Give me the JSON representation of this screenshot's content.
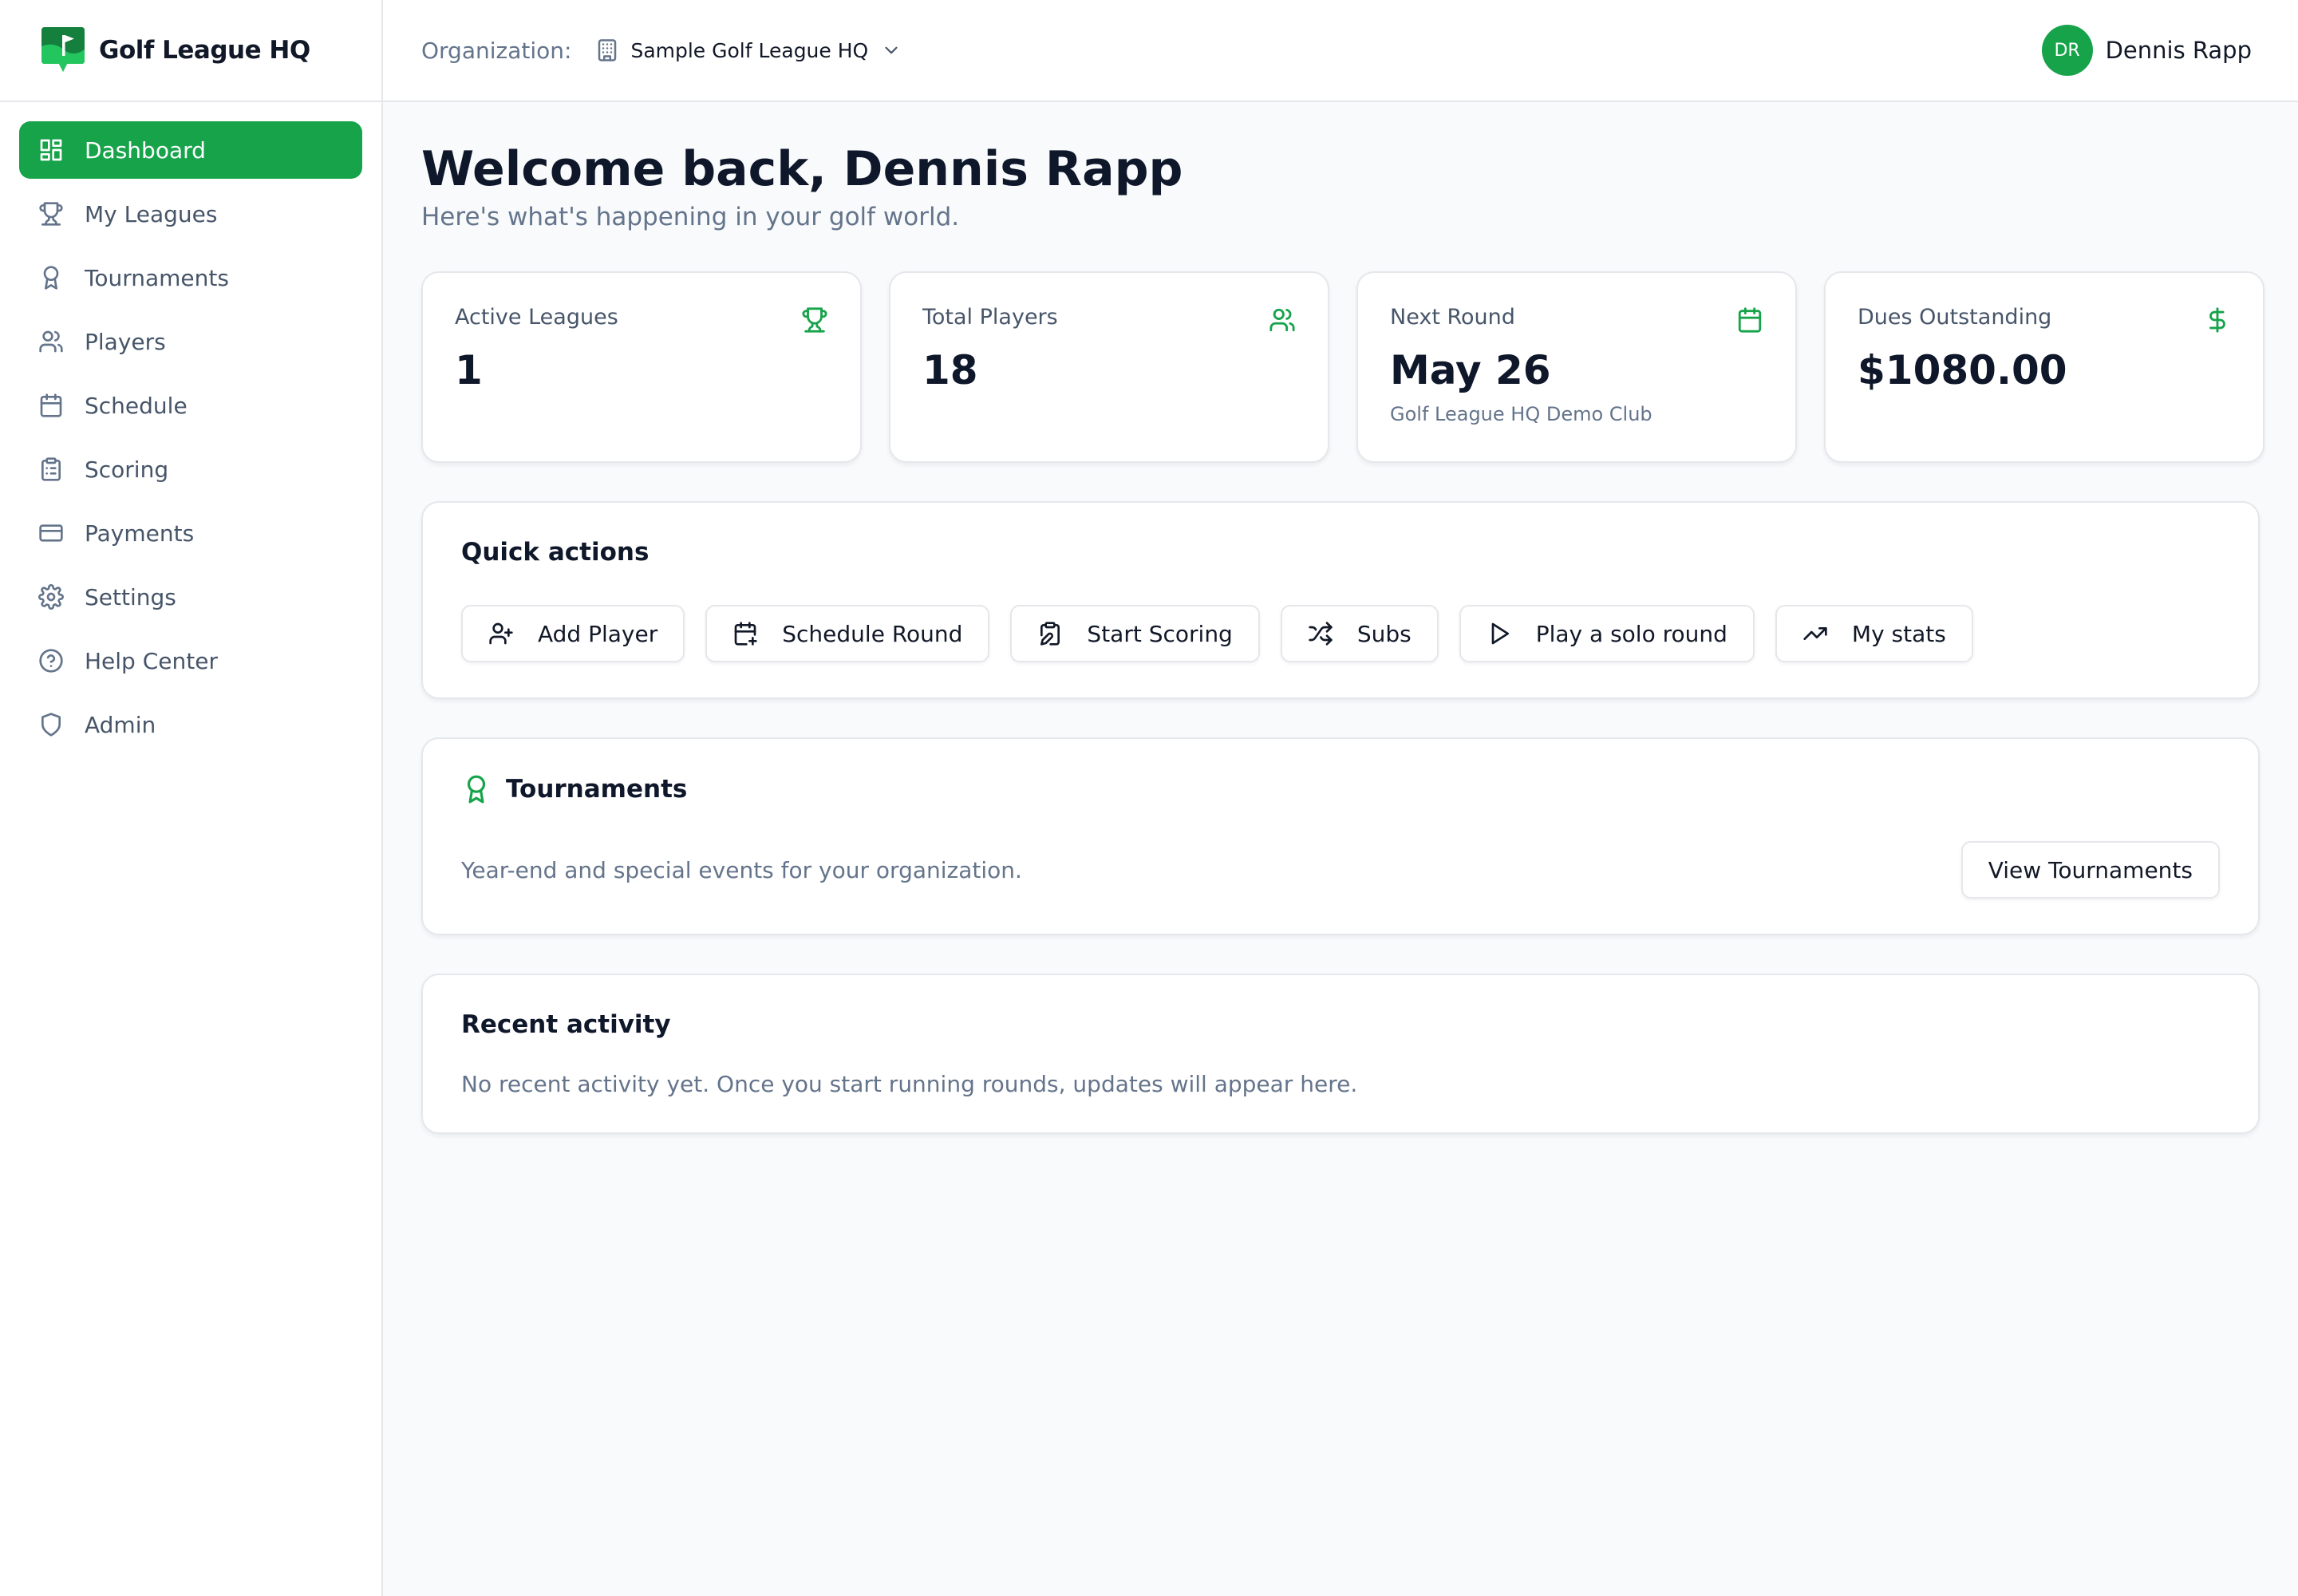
{
  "brand": {
    "name": "Golf League HQ",
    "color": "#16a34a"
  },
  "sidebar": {
    "items": [
      {
        "label": "Dashboard",
        "icon": "dashboard-icon",
        "active": true
      },
      {
        "label": "My Leagues",
        "icon": "trophy-icon"
      },
      {
        "label": "Tournaments",
        "icon": "award-icon"
      },
      {
        "label": "Players",
        "icon": "users-icon"
      },
      {
        "label": "Schedule",
        "icon": "calendar-icon"
      },
      {
        "label": "Scoring",
        "icon": "clipboard-icon"
      },
      {
        "label": "Payments",
        "icon": "credit-card-icon"
      },
      {
        "label": "Settings",
        "icon": "gear-icon"
      },
      {
        "label": "Help Center",
        "icon": "help-circle-icon"
      },
      {
        "label": "Admin",
        "icon": "shield-icon"
      }
    ]
  },
  "header": {
    "org_label": "Organization:",
    "org_value": "Sample Golf League HQ",
    "user": {
      "initials": "DR",
      "name": "Dennis Rapp"
    }
  },
  "main": {
    "title": "Welcome back, Dennis Rapp",
    "subtitle": "Here's what's happening in your golf world.",
    "stats": [
      {
        "label": "Active Leagues",
        "value": "1",
        "icon": "trophy-icon"
      },
      {
        "label": "Total Players",
        "value": "18",
        "icon": "users-icon"
      },
      {
        "label": "Next Round",
        "value": "May 26",
        "sub": "Golf League HQ Demo Club",
        "icon": "calendar-icon"
      },
      {
        "label": "Dues Outstanding",
        "value": "$1080.00",
        "icon": "dollar-icon"
      }
    ],
    "quick_actions": {
      "title": "Quick actions",
      "buttons": [
        {
          "label": "Add Player",
          "icon": "user-plus-icon"
        },
        {
          "label": "Schedule Round",
          "icon": "calendar-plus-icon"
        },
        {
          "label": "Start Scoring",
          "icon": "clipboard-pen-icon"
        },
        {
          "label": "Subs",
          "icon": "shuffle-icon"
        },
        {
          "label": "Play a solo round",
          "icon": "play-icon"
        },
        {
          "label": "My stats",
          "icon": "trending-up-icon"
        }
      ]
    },
    "tournaments": {
      "title": "Tournaments",
      "description": "Year-end and special events for your organization.",
      "button": "View Tournaments"
    },
    "recent": {
      "title": "Recent activity",
      "text": "No recent activity yet. Once you start running rounds, updates will appear here."
    }
  }
}
